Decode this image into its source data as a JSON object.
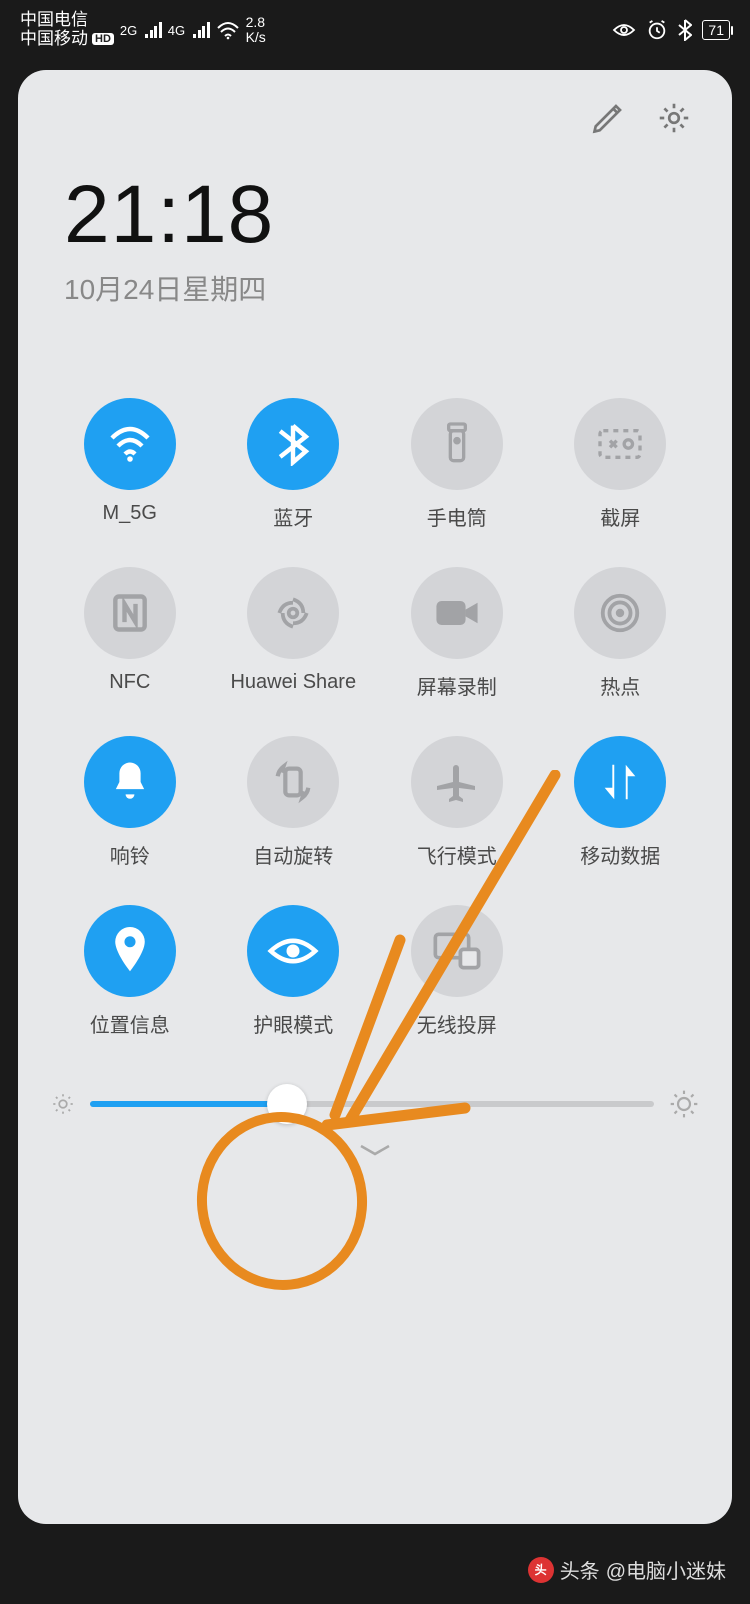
{
  "status": {
    "carrier1": "中国电信",
    "carrier2": "中国移动",
    "hd": "HD",
    "net2g": "2G",
    "net4g": "4G",
    "speed_top": "2.8",
    "speed_bottom": "K/s",
    "battery": "71"
  },
  "time": "21:18",
  "date": "10月24日星期四",
  "tiles": [
    {
      "label": "M_5G",
      "icon": "wifi",
      "active": true
    },
    {
      "label": "蓝牙",
      "icon": "bluetooth",
      "active": true
    },
    {
      "label": "手电筒",
      "icon": "flashlight",
      "active": false
    },
    {
      "label": "截屏",
      "icon": "screenshot",
      "active": false
    },
    {
      "label": "NFC",
      "icon": "nfc",
      "active": false
    },
    {
      "label": "Huawei Share",
      "icon": "share",
      "active": false
    },
    {
      "label": "屏幕录制",
      "icon": "record",
      "active": false
    },
    {
      "label": "热点",
      "icon": "hotspot",
      "active": false
    },
    {
      "label": "响铃",
      "icon": "bell",
      "active": true
    },
    {
      "label": "自动旋转",
      "icon": "rotate",
      "active": false
    },
    {
      "label": "飞行模式",
      "icon": "airplane",
      "active": false
    },
    {
      "label": "移动数据",
      "icon": "data",
      "active": true
    },
    {
      "label": "位置信息",
      "icon": "location",
      "active": true
    },
    {
      "label": "护眼模式",
      "icon": "eye",
      "active": true
    },
    {
      "label": "无线投屏",
      "icon": "cast",
      "active": false
    }
  ],
  "brightness_pct": 35,
  "watermark": {
    "prefix": "头条",
    "handle": "@电脑小迷妹"
  }
}
